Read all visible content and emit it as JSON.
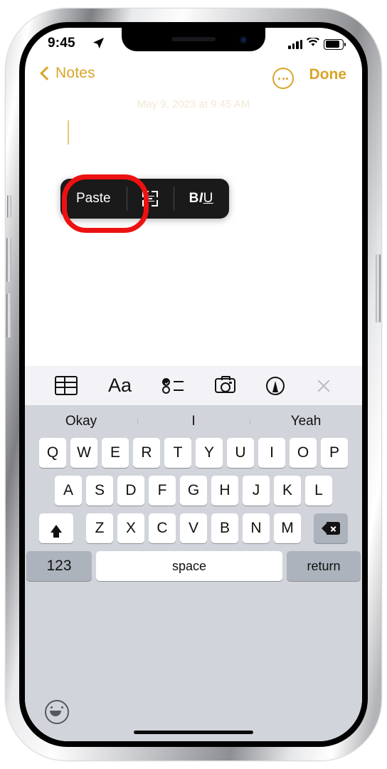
{
  "status_bar": {
    "time": "9:45",
    "location_icon": "location-arrow-icon",
    "signal_icon": "cellular-signal-icon",
    "wifi_icon": "wifi-icon",
    "battery_icon": "battery-full-icon"
  },
  "nav_bar": {
    "back_label": "Notes",
    "back_icon": "chevron-left-icon",
    "more_icon": "ellipsis-circle-icon",
    "done_label": "Done",
    "accent_color": "#d9a42a"
  },
  "note": {
    "date_text": "May 9, 2023 at 9:45 AM",
    "body_text": "",
    "caret_color": "#e7c878"
  },
  "paste_menu": {
    "items": [
      {
        "label": "Paste",
        "name": "paste-option",
        "icon": ""
      },
      {
        "label": "",
        "name": "scan-text-option",
        "icon": "scan-text-icon"
      },
      {
        "label": "BIU",
        "name": "format-biu-option",
        "icon": ""
      }
    ],
    "biu": {
      "bold": "B",
      "italic": "I",
      "underline": "U"
    },
    "background_color": "#1a1a1a",
    "highlight_color": "#ee1111"
  },
  "notes_toolbar": {
    "items": [
      {
        "name": "table-icon",
        "label": "table"
      },
      {
        "name": "format-aa-icon",
        "label": "Aa"
      },
      {
        "name": "checklist-icon",
        "label": "checklist"
      },
      {
        "name": "camera-icon",
        "label": "camera"
      },
      {
        "name": "markup-pen-icon",
        "label": "markup"
      },
      {
        "name": "close-icon",
        "label": "close"
      }
    ],
    "aa_label": "Aa",
    "background_color": "#f3f3f7"
  },
  "keyboard": {
    "predictive": [
      "Okay",
      "I",
      "Yeah"
    ],
    "row1": [
      "Q",
      "W",
      "E",
      "R",
      "T",
      "Y",
      "U",
      "I",
      "O",
      "P"
    ],
    "row2": [
      "A",
      "S",
      "D",
      "F",
      "G",
      "H",
      "J",
      "K",
      "L"
    ],
    "row3": [
      "Z",
      "X",
      "C",
      "V",
      "B",
      "N",
      "M"
    ],
    "shift_icon": "shift-arrow-icon",
    "delete_icon": "backspace-icon",
    "numbers_label": "123",
    "space_label": "space",
    "return_label": "return",
    "emoji_icon": "emoji-smiley-icon",
    "background_color": "#d1d4da",
    "key_color": "#ffffff",
    "fn_key_color": "#adb3bd"
  }
}
